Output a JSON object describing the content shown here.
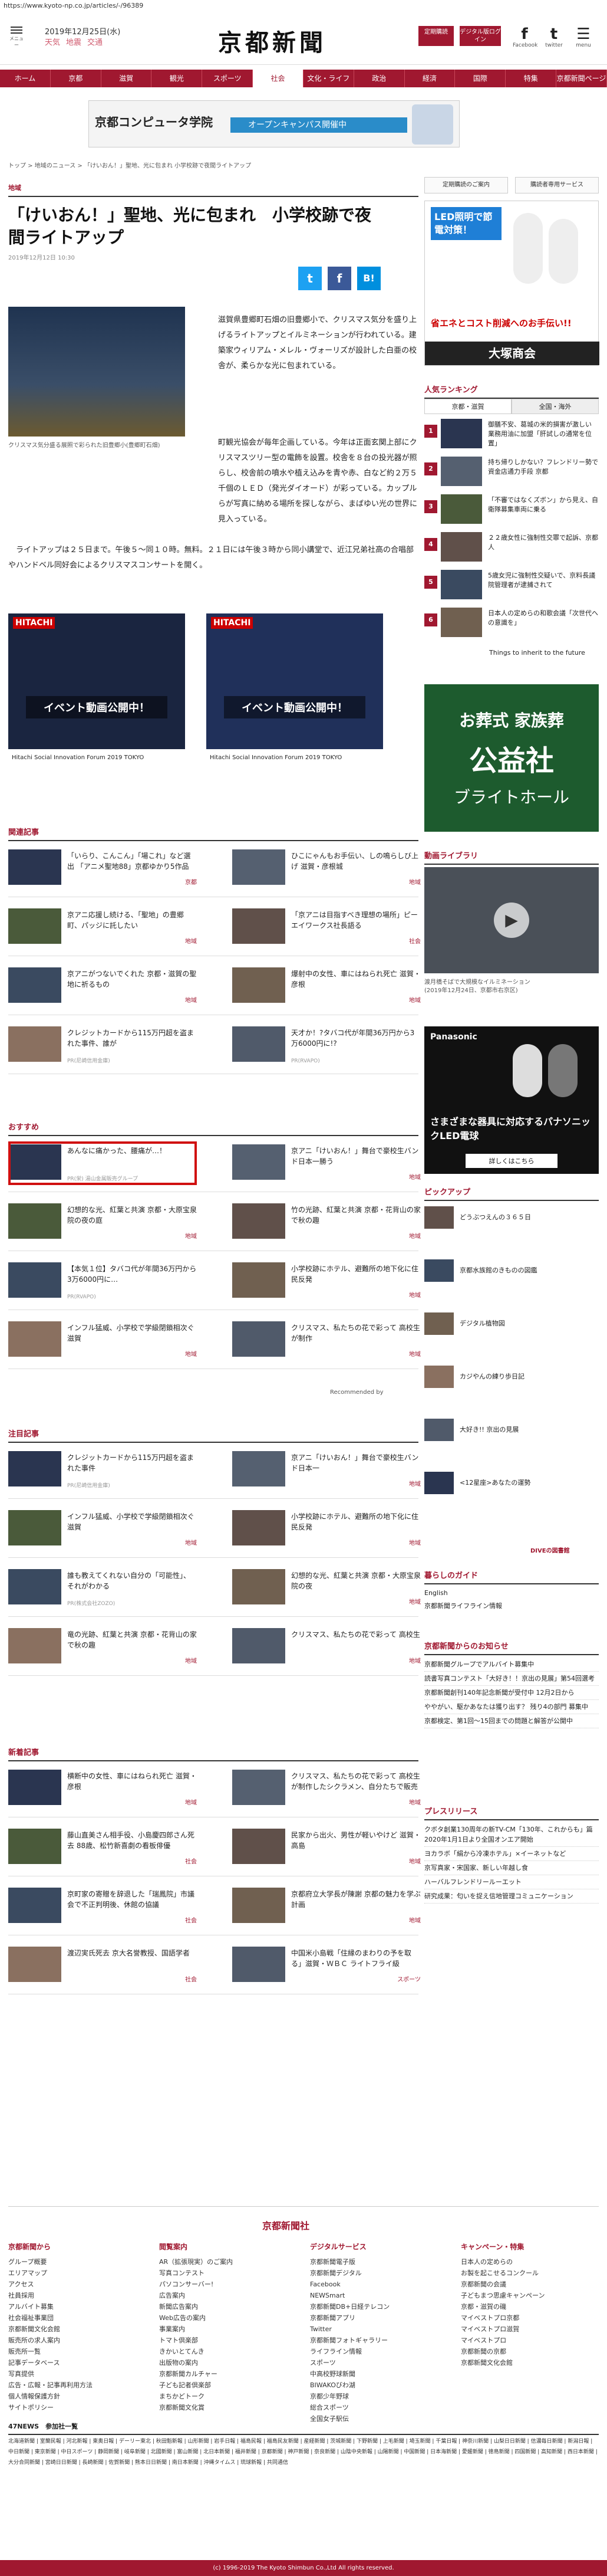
{
  "url": "https://www.kyoto-np.co.jp/articles/-/96389",
  "header": {
    "menu_label": "メニュー",
    "date": "2019年12月25日(水)",
    "weather": [
      "天気",
      "地震",
      "交通"
    ],
    "logo": "京都新聞",
    "btn_subscribe": "定期購読",
    "btn_digital": "デジタル版ログイン",
    "social": [
      {
        "icon": "f",
        "label": "Facebook"
      },
      {
        "icon": "t",
        "label": "twitter"
      },
      {
        "icon": "☰",
        "label": "menu"
      }
    ]
  },
  "nav": [
    "ホーム",
    "京都",
    "滋賀",
    "観光",
    "スポーツ",
    "社会",
    "文化・ライフ",
    "政治",
    "経済",
    "国際",
    "特集",
    "京都新聞ページ"
  ],
  "nav_active": 5,
  "banner": {
    "left": "京都コンピュータ学院",
    "right": "オープンキャンパス開催中"
  },
  "breadcrumb": "トップ > 地域のニュース > 「けいおん！」聖地、光に包まれ 小学校跡で夜間ライトアップ",
  "category": "地域",
  "article": {
    "title": "「けいおん！」聖地、光に包まれ　小学校跡で夜間ライトアップ",
    "timestamp": "2019年12月12日 10:30",
    "share": [
      {
        "icon": "t",
        "color": "#1da1f2"
      },
      {
        "icon": "f",
        "color": "#3b5998"
      },
      {
        "icon": "B!",
        "color": "#008fde"
      }
    ],
    "photo_caption": "クリスマス気分盛る展照で彩られた旧豊郷小(豊郷町石畑)",
    "para1": "滋賀県豊郷町石畑の旧豊郷小で、クリスマス気分を盛り上げるライトアップとイルミネーションが行われている。建築家ウィリアム・メレル・ヴォーリズが設計した白亜の校舎が、柔らかな光に包まれている。",
    "para2": "町観光協会が毎年企画している。今年は正面玄関上部にクリスマスツリー型の電飾を設置。校舎を８台の投光器が照らし、校舎前の噴水や植え込みを青や赤、白など約２万５千個のＬＥＤ（発光ダイオード）が彩っている。カップルらが写真に納める場所を探しながら、まばゆい光の世界に見入っている。",
    "para3": "ライトアップは２５日まで。午後５〜同１０時。無料。２１日には午後３時から同小講堂で、近江兄弟社高の合唱部やハンドベル同好会によるクリスマスコンサートを開く。"
  },
  "ads_inline": [
    {
      "brand": "HITACHI",
      "title": "イベント動画公開中！",
      "footer": "Hitachi Social Innovation Forum 2019 TOKYO"
    },
    {
      "brand": "HITACHI",
      "title": "イベント動画公開中！",
      "footer": "Hitachi Social Innovation Forum 2019 TOKYO"
    }
  ],
  "related": {
    "heading": "関連記事",
    "items": [
      {
        "text": "「いらり、こんこん」「場これ」など選出 「アニメ聖地88」京都ゆかり5作品",
        "tag": "京都"
      },
      {
        "text": "ひこにゃんもお手伝い、しの鳴らしび上げ 滋賀・彦根城",
        "tag": "地域"
      },
      {
        "text": "京アニ応援し続ける、「聖地」の豊郷町、パッジに託したい",
        "tag": "地域"
      },
      {
        "text": "「京アニは目指すべき理想の場所」ピーエイワークス社長語る",
        "tag": "社会"
      },
      {
        "text": "京アニがつないでくれた 京都・滋賀の聖地に祈るもの",
        "tag": "地域"
      },
      {
        "text": "爆射中の女性、車にはねられ死亡 滋賀・彦根",
        "tag": "地域"
      },
      {
        "text": "クレジットカードから115万円超を盗まれた事件、誰が",
        "pr": "PR(尼崎信用金庫)"
      },
      {
        "text": "天才か！?タバコ代が年間36万円から3万6000円に!?",
        "pr": "PR(RVAPO)"
      }
    ]
  },
  "recommend": {
    "heading": "おすすめ",
    "items": [
      {
        "text": "あんなに痛かった、腰痛が…！",
        "pr": "PR(栄) 湯山金属販売グループ"
      },
      {
        "text": "京アニ「けいおん！」舞台で豪校生バンド日本一勝う",
        "tag": "地域"
      },
      {
        "text": "幻想的な光、紅葉と共演 京都・大原宝泉院の夜の庭",
        "tag": "地域"
      },
      {
        "text": "竹の光跡、紅葉と共演 京都・花背山の家で秋の趣",
        "tag": "地域"
      },
      {
        "text": "【本気１位】タバコ代が年間36万円から3万6000円に…",
        "pr": "PR(RVAPO)"
      },
      {
        "text": "小学校跡にホテル、避難所の地下化に住民反発",
        "tag": "地域"
      },
      {
        "text": "インフル猛威、小学校で学級閉鎖相次ぐ 滋賀",
        "tag": "地域"
      },
      {
        "text": "クリスマス、私たちの花で彩って 高校生が制作",
        "tag": "地域"
      }
    ],
    "powered": "Recommended by"
  },
  "attention": {
    "heading": "注目記事",
    "items": [
      {
        "text": "クレジットカードから115万円超を盗まれた事件",
        "pr": "PR(尼崎信用金庫)"
      },
      {
        "text": "京アニ「けいおん！」舞台で豪校生バンド日本一",
        "tag": "地域"
      },
      {
        "text": "インフル猛威、小学校で学級閉鎖相次ぐ 滋賀",
        "tag": "地域"
      },
      {
        "text": "小学校跡にホテル、避難所の地下化に住民反発",
        "tag": "地域"
      },
      {
        "text": "誰も教えてくれない自分の「可能性」、それがわかる",
        "pr": "PR(株式会社ZOZO)"
      },
      {
        "text": "幻想的な光、紅葉と共演 京都・大原宝泉院の夜",
        "tag": "地域"
      },
      {
        "text": "竜の光跡、紅葉と共演 京都・花背山の家で秋の趣",
        "tag": "地域"
      },
      {
        "text": "クリスマス、私たちの花で彩って 高校生",
        "tag": "地域"
      }
    ]
  },
  "latest": {
    "heading": "新着記事",
    "items": [
      {
        "text": "横断中の女性、車にはねられ死亡 滋賀・彦根",
        "tag": "地域"
      },
      {
        "text": "クリスマス、私たちの花で彩って 高校生が制作したシクラメン、自分たちで販売",
        "tag": "地域"
      },
      {
        "text": "藤山直美さん相手役、小島慶四郎さん死去 88歳、松竹新喜劇の看板俳優",
        "tag": "社会"
      },
      {
        "text": "民家から出火、男性が軽いやけど 滋賀・高島",
        "tag": "地域"
      },
      {
        "text": "京町家の寄贈を辞退した「瑞鳳院」市議会で不正判明後、休館の協議",
        "tag": "社会"
      },
      {
        "text": "京都府立大学長が陳謝 京都の魅力を学ぶ計画",
        "tag": "地域"
      },
      {
        "text": "渡辺実氏死去 京大名誉教授、国語学者",
        "tag": "社会"
      },
      {
        "text": "中国米小島戦「住縁のまわりの予を取る」滋賀・ＷＢＣ ライトフライ級",
        "tag": "スポーツ"
      }
    ]
  },
  "right": {
    "btn1": "定期購読のご案内",
    "btn2": "購読者専用サービス",
    "ad_led": {
      "title": "LED照明で節電対策！",
      "sub": "省エネとコスト削減へのお手伝い!!",
      "brand": "大塚商会"
    },
    "ranking": {
      "heading": "人気ランキング",
      "tabs": [
        "京都・滋賀",
        "全国・海外"
      ],
      "items": [
        {
          "num": "1",
          "text": "御膳不安、葛城の米的損害が激しい 業務用油に加盟「肝試しの通常を位置」"
        },
        {
          "num": "2",
          "text": "持ち帰りしかない？フレンドリー勢で資金店通力手段 京都"
        },
        {
          "num": "3",
          "text": "「不審ではなくズボン」から見え、自衛隊募集車両に乗る"
        },
        {
          "num": "4",
          "text": "２２歳女性に強制性交罪で起訴、京都人"
        },
        {
          "num": "5",
          "text": "5歳女児に強制性交疑いで、京料長議院管理者が逮捕されて"
        },
        {
          "num": "6",
          "text": "日本人の定めらの和歌会議「次世代への意識を」"
        }
      ]
    },
    "things": "Things to inherit to the future",
    "ad_funeral": {
      "l1": "お葬式 家族葬",
      "l2": "公益社",
      "l3": "ブライトホール"
    },
    "video": {
      "heading": "動画ライブラリ",
      "caption": "渡月橋そばで大規模なイルミネーション",
      "sub": "(2019年12月24日、京都市右京区)"
    },
    "ad_panasonic": {
      "brand": "Panasonic",
      "title": "さまざまな器具に対応するパナソニックLED電球",
      "btn": "詳しくはこちら"
    },
    "pickup": {
      "heading": "ピックアップ",
      "items": [
        "どうぶつえんの３６５日",
        "京都水族館のきものの図鑑",
        "デジタル植物図",
        "カジやんの練り歩日記",
        "大好き!! 京出の見展",
        "<12星座>あなたの運勢"
      ]
    },
    "dive": "DIVEの図書館",
    "guide": {
      "heading": "暮らしのガイド",
      "items": [
        "English",
        "京都新聞ライフライン情報"
      ]
    },
    "notice": {
      "heading": "京都新聞からのお知らせ",
      "items": [
        "京都新聞グループでアルバイト募集中",
        "読書写真コンテスト「大好き！！京出の見展」第54回選考",
        "京都新聞創刊140年記念新聞が受付中 12月2日から",
        "ややがい、駆かあなたは獲り出す？ 残り4の部門 募集中",
        "京都検定、第1回〜15回までの問題と解答が公開中"
      ]
    },
    "press": {
      "heading": "プレスリリース",
      "items": [
        "クボタ創業130周年の新TV-CM「130年、これからも」篇 2020年1月1日より全国オンエア開始",
        "ヨカラボ「絹から冷凍ホテル」×イーネットなど",
        "京写真家・宋国家、新しい年越し食",
        "ハーバルフレンドリールーエット",
        "研究成果：匂いを捉え信地管理コミュニケーション"
      ]
    }
  },
  "footer": {
    "logo": "京都新聞社",
    "cols": [
      {
        "h": "京都新聞から",
        "items": [
          "グループ概要",
          "エリアマップ",
          "アクセス",
          "社員採用",
          "アルバイト募集",
          "社会福祉事業団",
          "京都新聞文化会館",
          "販売所の求人案内",
          "販売所一覧",
          "記事データベース",
          "写真提供",
          "広告・広報・記事再利用方法",
          "個人情報保護方針",
          "サイトポリシー"
        ]
      },
      {
        "h": "閲覧案内",
        "items": [
          "AR（拡張現実）のご案内",
          "写真コンテスト",
          "パソコンサーバー!",
          "広告案内",
          "新聞広告案内",
          "Web広告の案内",
          "事業案内",
          "トマト倶楽部",
          "きかいとてんき",
          "出版物の案内",
          "京都新聞カルチャー",
          "子ども記者倶楽部",
          "まちかどトーク",
          "京都新聞文化賞"
        ]
      },
      {
        "h": "デジタルサービス",
        "items": [
          "京都新聞電子版",
          "京都新聞デジタル",
          "Facebook",
          "NEWSmart",
          "京都新聞DB+日経テレコン",
          "京都新聞アプリ",
          "Twitter",
          "京都新聞フォトギャラリー",
          "ライフライン情報",
          "スポーツ",
          "中高校野球新聞",
          "BIWAKOびわ湖",
          "京都少年野球",
          "総合スポーツ",
          "全国女子駅伝"
        ]
      },
      {
        "h": "キャンペーン・特集",
        "items": [
          "日本人の定めらの",
          "お製を起こせるコンクール",
          "京都新聞の会議",
          "子どもまつ思慮キャンペーン",
          "京都・滋賀の磯",
          "マイベストプロ京都",
          "マイベストプロ滋賀",
          "マイベストプロ",
          "京都新聞の京都",
          "京都新聞文化会館"
        ]
      }
    ],
    "related_heading": "47NEWS　参加社一覧",
    "related": "北海道新聞 | 室蘭民報 | 河北新報 | 東奥日報 | デーリー東北 | 秋田魁新報 | 山形新聞 | 岩手日報 | 福島民報 | 福島民友新聞 | 産経新聞 | 茨城新聞 | 下野新聞 | 上毛新聞 | 埼玉新聞 | 千葉日報 | 神奈川新聞 | 山梨日日新聞 | 信濃毎日新聞 | 新潟日報 | 中日新聞 | 東京新聞 | 中日スポーツ | 静岡新聞 | 岐阜新聞 | 北國新聞 | 富山新聞 | 北日本新聞 | 福井新聞 | 京都新聞 | 神戸新聞 | 奈良新聞 | 山陰中央新報 | 山陽新聞 | 中国新聞 | 日本海新聞 | 愛媛新聞 | 徳島新聞 | 四国新聞 | 高知新聞 | 西日本新聞 | 大分合同新聞 | 宮崎日日新聞 | 長崎新聞 | 佐賀新聞 | 熊本日日新聞 | 南日本新聞 | 沖縄タイムス | 琉球新報 | 共同通信",
    "copyright": "(c) 1996-2019 The Kyoto Shimbun Co.,Ltd All rights reserved."
  },
  "colors": {
    "brand": "#a01830"
  }
}
